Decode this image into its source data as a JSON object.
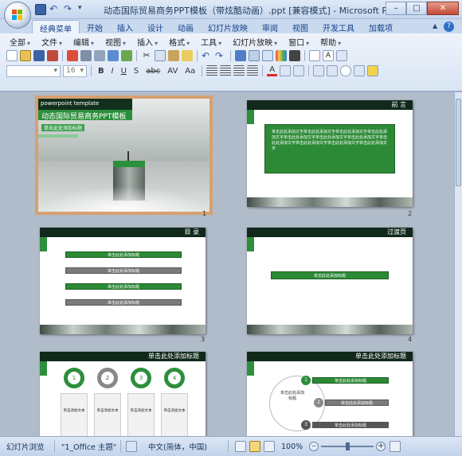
{
  "window": {
    "title": "动态国际贸易商务PPT模板（带炫酷动画）.ppt [兼容模式] - Microsoft PowerPoint",
    "buttons": {
      "minimize": "–",
      "maximize": "□",
      "close": "✕"
    }
  },
  "ribbon": {
    "tabs": [
      "经典菜单",
      "开始",
      "插入",
      "设计",
      "动画",
      "幻灯片放映",
      "审阅",
      "视图",
      "开发工具",
      "加载项"
    ],
    "active_tab": "经典菜单",
    "menu_items": [
      "全部",
      "文件",
      "编辑",
      "视图",
      "插入",
      "格式",
      "工具",
      "幻灯片放映",
      "窗口",
      "帮助"
    ],
    "font_size": "16"
  },
  "slides": [
    {
      "num": "1",
      "title_small": "powerpoint template",
      "title_main": "动态国际贸易商务PPT模板",
      "subtitle": "单击此处添加标题"
    },
    {
      "num": "2",
      "header": "前 言",
      "body_text": "单击此处添加文字单击此处添加文字单击此处添加文字单击此处添加文字单击此处添加文字单击此处添加文字单击此处添加文字单击此处添加文字单击此处添加文字单击此处添加文字单击此处添加文字"
    },
    {
      "num": "3",
      "header": "目 录",
      "items": [
        "单击此处添加标题",
        "单击此处添加标题",
        "单击此处添加标题",
        "单击此处添加标题"
      ]
    },
    {
      "num": "4",
      "header": "过渡页",
      "bar": "单击此处添加标题"
    },
    {
      "num": "5",
      "header": "单击此处添加标题",
      "circles": [
        "1",
        "2",
        "3",
        "4"
      ],
      "caption": "单击添加文本"
    },
    {
      "num": "6",
      "header": "单击此处添加标题",
      "center": "单击此处添加标题",
      "items": [
        "单击此处添加标题",
        "单击此处添加标题",
        "单击此处添加标题"
      ],
      "nums": [
        "1",
        "2",
        "3"
      ]
    }
  ],
  "status": {
    "view": "幻灯片浏览",
    "theme": "\"1_Office 主题\"",
    "language": "中文(简体，中国)",
    "zoom": "100%"
  }
}
